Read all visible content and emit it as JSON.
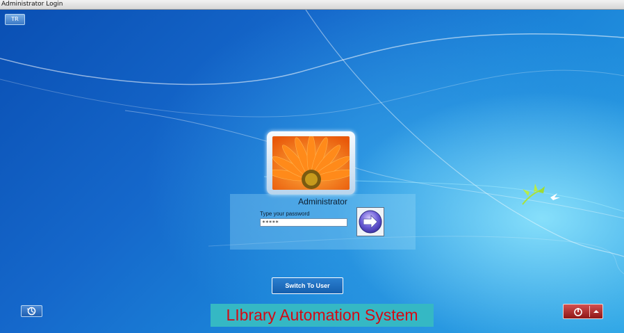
{
  "window": {
    "title": "Administrator Login"
  },
  "toolbar": {
    "language": "TR"
  },
  "login": {
    "username": "Administrator",
    "password_label": "Type your password",
    "password_value": "*****"
  },
  "buttons": {
    "switch_user": "Switch To User"
  },
  "app": {
    "title": "LIbrary Automation System"
  },
  "icons": {
    "submit": "arrow-right-icon",
    "ease_of_access": "ease-of-access-icon",
    "power": "power-icon",
    "power_options": "chevron-up-icon"
  },
  "colors": {
    "app_title_text": "#d40a14",
    "app_title_bg": "#35b8c4",
    "desktop": "#1568cb"
  }
}
